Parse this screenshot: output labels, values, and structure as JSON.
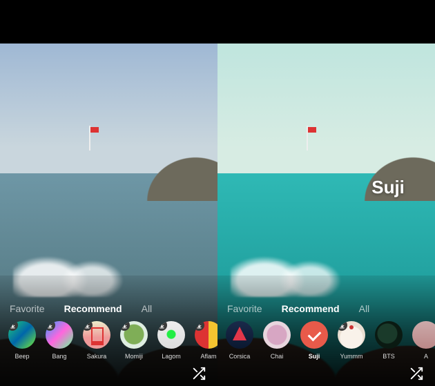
{
  "overlay_filter_name": "Suji",
  "tabs": {
    "favorite": "Favorite",
    "recommend": "Recommend",
    "all": "All"
  },
  "left_panel": {
    "active_tab": "recommend",
    "filters": [
      {
        "name": "Beep",
        "thumb": "g-beep",
        "downloadable": true,
        "selected": false
      },
      {
        "name": "Bang",
        "thumb": "g-bang",
        "downloadable": true,
        "selected": false
      },
      {
        "name": "Sakura",
        "thumb": "g-sakura",
        "downloadable": true,
        "selected": false
      },
      {
        "name": "Momiji",
        "thumb": "g-momiji",
        "downloadable": true,
        "selected": false
      },
      {
        "name": "Lagom",
        "thumb": "g-lagom",
        "downloadable": true,
        "selected": false
      },
      {
        "name": "Aflam",
        "thumb": "g-aflam",
        "downloadable": true,
        "selected": false
      }
    ]
  },
  "right_panel": {
    "active_tab": "recommend",
    "filters": [
      {
        "name": "Corsica",
        "thumb": "g-corsica",
        "downloadable": false,
        "selected": false
      },
      {
        "name": "Chai",
        "thumb": "g-chai",
        "downloadable": false,
        "selected": false
      },
      {
        "name": "Suji",
        "thumb": "g-suji",
        "downloadable": false,
        "selected": true
      },
      {
        "name": "Yummm",
        "thumb": "g-yummm",
        "downloadable": true,
        "selected": false
      },
      {
        "name": "BTS",
        "thumb": "g-bts",
        "downloadable": false,
        "selected": false
      },
      {
        "name": "A",
        "thumb": "g-last",
        "downloadable": false,
        "selected": false
      }
    ]
  },
  "icons": {
    "download": "download-icon",
    "shuffle": "shuffle-icon"
  }
}
